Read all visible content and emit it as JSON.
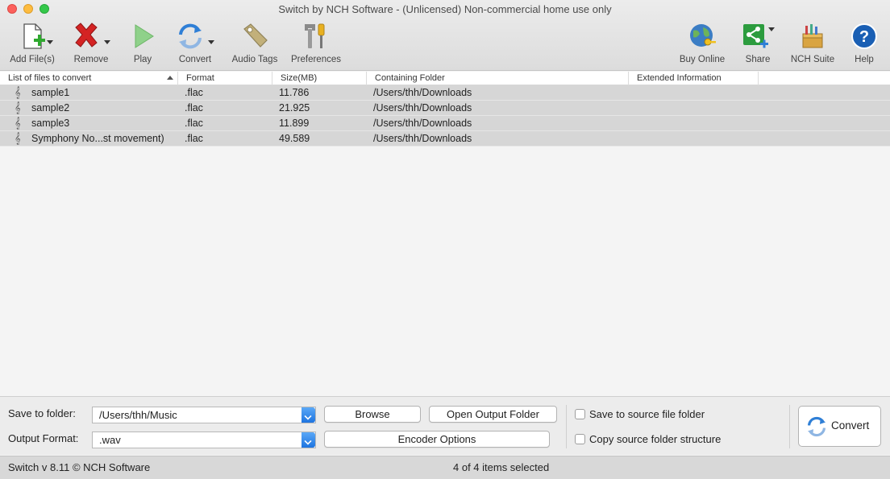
{
  "window": {
    "title": "Switch by NCH Software - (Unlicensed) Non-commercial home use only"
  },
  "toolbar": {
    "add_files": "Add File(s)",
    "remove": "Remove",
    "play": "Play",
    "convert": "Convert",
    "audio_tags": "Audio Tags",
    "preferences": "Preferences",
    "buy_online": "Buy Online",
    "share": "Share",
    "nch_suite": "NCH Suite",
    "help": "Help"
  },
  "columns": {
    "name": "List of files to convert",
    "format": "Format",
    "size": "Size(MB)",
    "folder": "Containing Folder",
    "extended": "Extended Information"
  },
  "files": [
    {
      "name": "sample1",
      "format": ".flac",
      "size": "11.786",
      "folder": "/Users/thh/Downloads"
    },
    {
      "name": "sample2",
      "format": ".flac",
      "size": "21.925",
      "folder": "/Users/thh/Downloads"
    },
    {
      "name": "sample3",
      "format": ".flac",
      "size": "11.899",
      "folder": "/Users/thh/Downloads"
    },
    {
      "name": "Symphony No...st movement)",
      "format": ".flac",
      "size": "49.589",
      "folder": "/Users/thh/Downloads"
    }
  ],
  "bottom": {
    "save_to_label": "Save to folder:",
    "save_to_value": "/Users/thh/Music",
    "output_format_label": "Output Format:",
    "output_format_value": ".wav",
    "browse": "Browse",
    "open_output_folder": "Open Output Folder",
    "encoder_options": "Encoder Options",
    "save_to_source": "Save to source file folder",
    "copy_structure": "Copy source folder structure",
    "convert": "Convert"
  },
  "status": {
    "version": "Switch v 8.11 © NCH Software",
    "selection": "4 of 4 items selected"
  },
  "colors": {
    "accent": "#1e74e0",
    "remove": "#d42323",
    "play": "#7fc97a"
  }
}
